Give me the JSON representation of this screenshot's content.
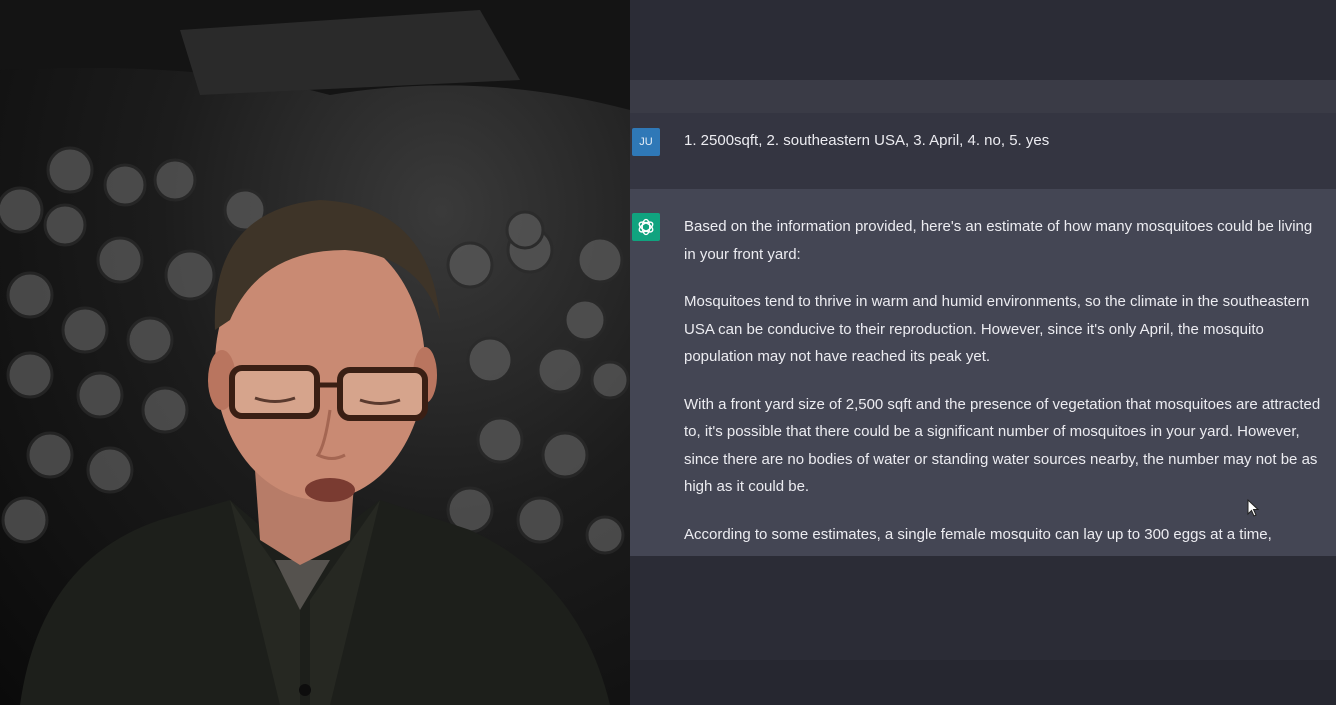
{
  "conversation": {
    "user_message": {
      "avatar_initials": "JU",
      "text": "1. 2500sqft, 2. southeastern USA, 3. April, 4. no, 5. yes"
    },
    "assistant_message": {
      "avatar_icon": "openai-logo-icon",
      "paragraphs": [
        "Based on the information provided, here's an estimate of how many mosquitoes could be living in your front yard:",
        "Mosquitoes tend to thrive in warm and humid environments, so the climate in the southeastern USA can be conducive to their reproduction. However, since it's only April, the mosquito population may not have reached its peak yet.",
        "With a front yard size of 2,500 sqft and the presence of vegetation that mosquitoes are attracted to, it's possible that there could be a significant number of mosquitoes in your yard. However, since there are no bodies of water or standing water sources nearby, the number may not be as high as it could be.",
        "According to some estimates, a single female mosquito can lay up to 300 eggs at a time,"
      ]
    }
  },
  "colors": {
    "user_avatar_bg": "#2f78b7",
    "assistant_avatar_bg": "#10a37f",
    "assistant_row_bg": "#444654",
    "user_row_bg": "#343541"
  }
}
